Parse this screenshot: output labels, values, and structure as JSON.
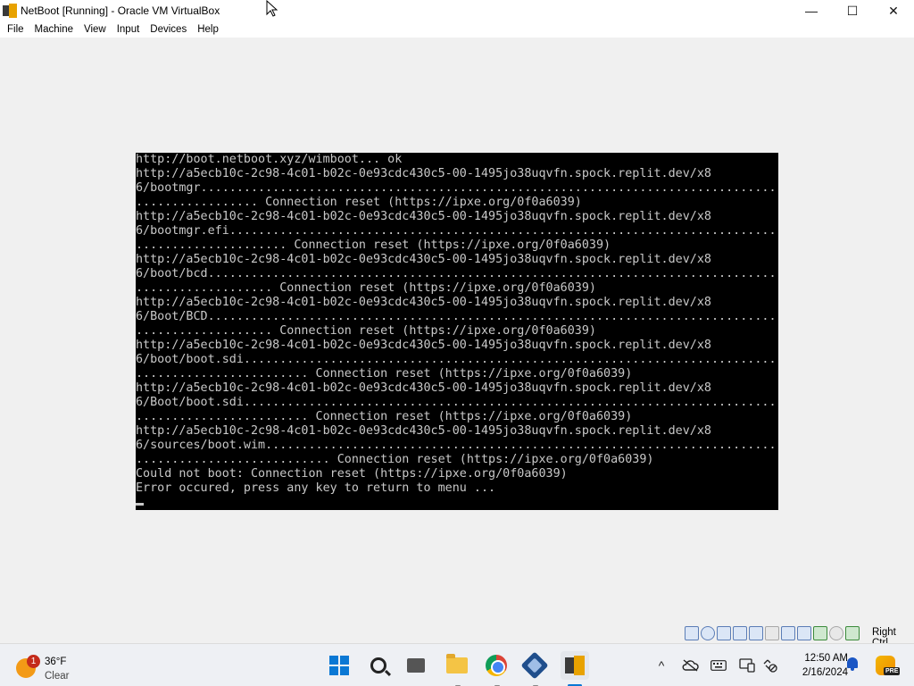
{
  "window": {
    "title": "NetBoot [Running] - Oracle VM VirtualBox",
    "app_icon": "virtualbox-vm-icon",
    "controls": {
      "minimize": "—",
      "maximize": "☐",
      "close": "✕"
    }
  },
  "menubar": {
    "items": [
      "File",
      "Machine",
      "View",
      "Input",
      "Devices",
      "Help"
    ]
  },
  "console": {
    "lines": [
      "http://boot.netboot.xyz/wimboot... ok",
      "http://a5ecb10c-2c98-4c01-b02c-0e93cdc430c5-00-1495jo38uqvfn.spock.replit.dev/x8",
      "6/bootmgr................................................................................",
      "................. Connection reset (https://ipxe.org/0f0a6039)",
      "http://a5ecb10c-2c98-4c01-b02c-0e93cdc430c5-00-1495jo38uqvfn.spock.replit.dev/x8",
      "6/bootmgr.efi............................................................................",
      "..................... Connection reset (https://ipxe.org/0f0a6039)",
      "http://a5ecb10c-2c98-4c01-b02c-0e93cdc430c5-00-1495jo38uqvfn.spock.replit.dev/x8",
      "6/boot/bcd...............................................................................",
      "................... Connection reset (https://ipxe.org/0f0a6039)",
      "http://a5ecb10c-2c98-4c01-b02c-0e93cdc430c5-00-1495jo38uqvfn.spock.replit.dev/x8",
      "6/Boot/BCD...............................................................................",
      "................... Connection reset (https://ipxe.org/0f0a6039)",
      "http://a5ecb10c-2c98-4c01-b02c-0e93cdc430c5-00-1495jo38uqvfn.spock.replit.dev/x8",
      "6/boot/boot.sdi..........................................................................",
      "........................ Connection reset (https://ipxe.org/0f0a6039)",
      "http://a5ecb10c-2c98-4c01-b02c-0e93cdc430c5-00-1495jo38uqvfn.spock.replit.dev/x8",
      "6/Boot/boot.sdi..........................................................................",
      "........................ Connection reset (https://ipxe.org/0f0a6039)",
      "http://a5ecb10c-2c98-4c01-b02c-0e93cdc430c5-00-1495jo38uqvfn.spock.replit.dev/x8",
      "6/sources/boot.wim.......................................................................",
      "........................... Connection reset (https://ipxe.org/0f0a6039)",
      "Could not boot: Connection reset (https://ipxe.org/0f0a6039)",
      "Error occured, press any key to return to menu ..."
    ]
  },
  "vm_status": {
    "icons": [
      "hard-disk-icon",
      "optical-drive-icon",
      "audio-icon",
      "network-icon",
      "usb-icon",
      "shared-folders-icon",
      "display-icon",
      "video-capture-icon",
      "cpu-icon",
      "mouse-integration-icon",
      "keyboard-capture-icon"
    ],
    "host_key": "Right Ctrl"
  },
  "taskbar": {
    "weather": {
      "temp": "36°F",
      "condition": "Clear",
      "badge": "1"
    },
    "apps": [
      "start-icon",
      "search-icon",
      "task-view-icon",
      "file-explorer-icon",
      "chrome-icon",
      "virtualbox-icon",
      "netboot-vm-icon"
    ],
    "tray": {
      "chevron": "^"
    },
    "clock": {
      "time": "12:50 AM",
      "date": "2/16/2024"
    },
    "copilot_badge": "PRE"
  }
}
